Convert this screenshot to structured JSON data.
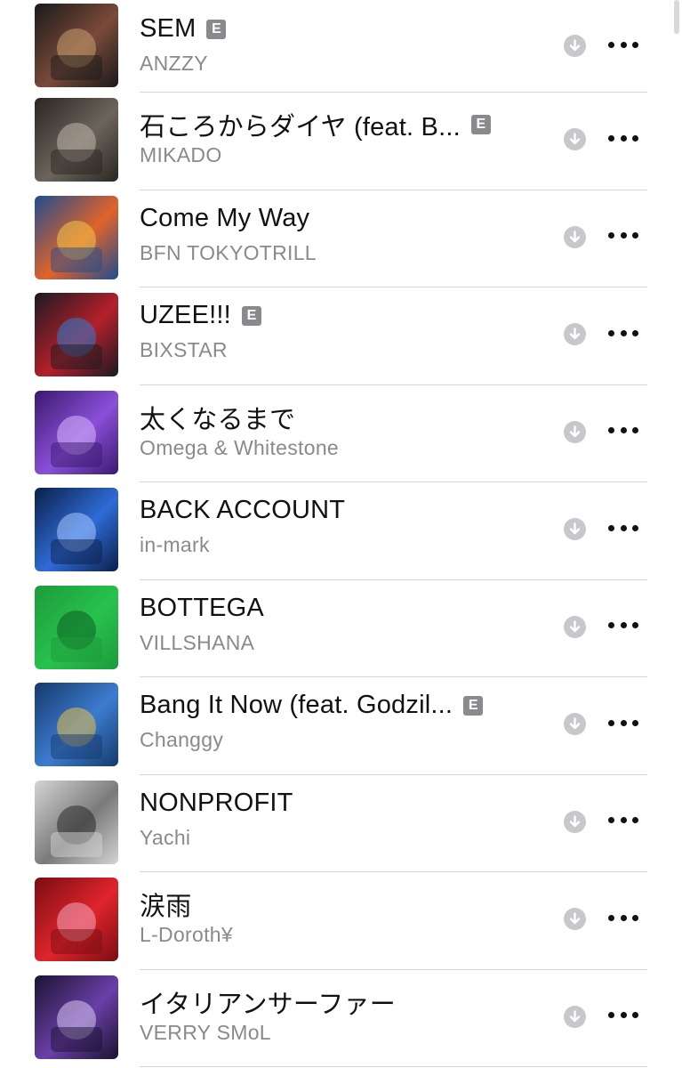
{
  "tracks": [
    {
      "title": "SEM",
      "artist": "ANZZY",
      "explicit": true,
      "explicit_label": "E",
      "art_colors": [
        "#1a1a1a",
        "#7a4a3a",
        "#c9a070"
      ]
    },
    {
      "title": "石ころからダイヤ (feat. B...",
      "artist": "MIKADO",
      "explicit": true,
      "explicit_label": "E",
      "art_colors": [
        "#2a2622",
        "#6b645c",
        "#bfb7aa"
      ]
    },
    {
      "title": "Come My Way",
      "artist": "BFN TOKYOTRILL",
      "explicit": false,
      "explicit_label": "",
      "art_colors": [
        "#1f4c8f",
        "#e0642a",
        "#f0c84a"
      ]
    },
    {
      "title": "UZEE!!!",
      "artist": "BIXSTAR",
      "explicit": true,
      "explicit_label": "E",
      "art_colors": [
        "#1b1a22",
        "#b3202a",
        "#2e7bd1"
      ]
    },
    {
      "title": "太くなるまで",
      "artist": "Omega & Whitestone",
      "explicit": false,
      "explicit_label": "",
      "art_colors": [
        "#3a1a6e",
        "#8a4fd8",
        "#d9b8ff"
      ]
    },
    {
      "title": "BACK ACCOUNT",
      "artist": "in-mark",
      "explicit": false,
      "explicit_label": "",
      "art_colors": [
        "#0b1f4a",
        "#2f6bd6",
        "#a8c8ff"
      ]
    },
    {
      "title": "BOTTEGA",
      "artist": "VILLSHANA",
      "explicit": false,
      "explicit_label": "",
      "art_colors": [
        "#1e9a3c",
        "#27c24d",
        "#0f5d22"
      ]
    },
    {
      "title": "Bang It Now (feat. Godzil...",
      "artist": "Changgy",
      "explicit": true,
      "explicit_label": "E",
      "art_colors": [
        "#163a6b",
        "#3d7bd0",
        "#e8c04a"
      ]
    },
    {
      "title": "NONPROFIT",
      "artist": "Yachi",
      "explicit": false,
      "explicit_label": "",
      "art_colors": [
        "#d4d4d4",
        "#7a7a7a",
        "#2a2a2a"
      ]
    },
    {
      "title": "涙雨",
      "artist": "L-Doroth¥",
      "explicit": false,
      "explicit_label": "",
      "art_colors": [
        "#7a0d12",
        "#e0242c",
        "#f2a8c0"
      ]
    },
    {
      "title": "イタリアンサーファー",
      "artist": "VERRY SMoL",
      "explicit": false,
      "explicit_label": "",
      "art_colors": [
        "#1b1230",
        "#6a3fa8",
        "#d8c8f0"
      ]
    }
  ]
}
